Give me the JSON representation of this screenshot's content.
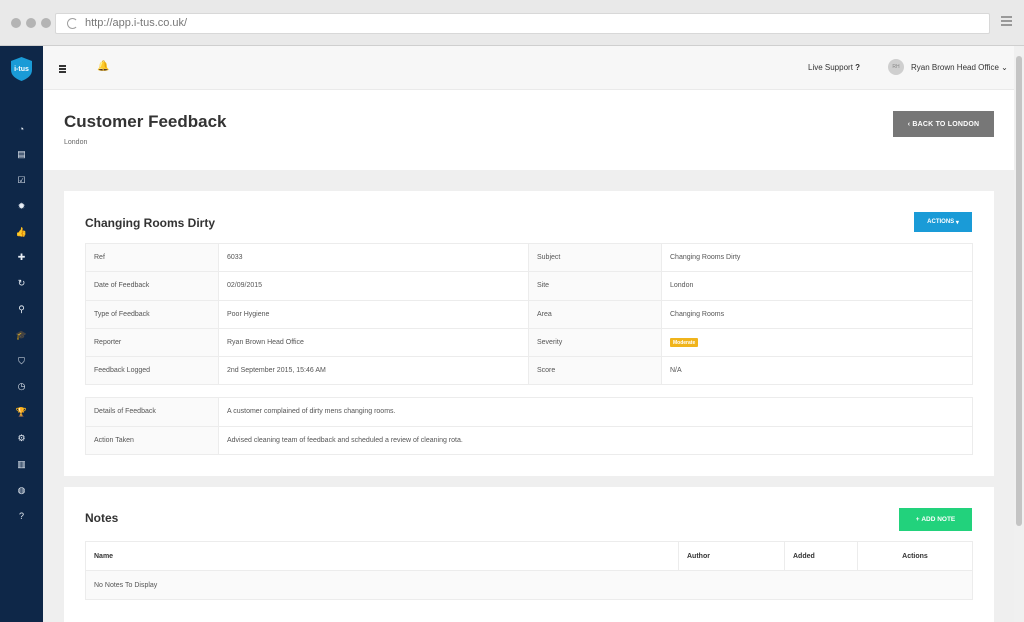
{
  "browser": {
    "url": "http://app.i-tus.co.uk/"
  },
  "brand": {
    "logo_text": "i-tus",
    "accent": "#1a9bd7"
  },
  "sidebar": {
    "items": [
      {
        "icon": "dashboard-icon",
        "glyph": "◔"
      },
      {
        "icon": "document-icon",
        "glyph": "▤"
      },
      {
        "icon": "checklist-icon",
        "glyph": "☑"
      },
      {
        "icon": "settings-cog-icon",
        "glyph": "✹"
      },
      {
        "icon": "thumbs-up-icon",
        "glyph": "👍"
      },
      {
        "icon": "medical-kit-icon",
        "glyph": "✚"
      },
      {
        "icon": "refresh-icon",
        "glyph": "↻"
      },
      {
        "icon": "search-zoom-icon",
        "glyph": "⚲"
      },
      {
        "icon": "graduation-cap-icon",
        "glyph": "🎓"
      },
      {
        "icon": "shield-icon",
        "glyph": "⛉"
      },
      {
        "icon": "clock-icon",
        "glyph": "◷"
      },
      {
        "icon": "trophy-icon",
        "glyph": "🏆"
      },
      {
        "icon": "gear-icon",
        "glyph": "⚙"
      },
      {
        "icon": "bar-chart-icon",
        "glyph": "▥"
      },
      {
        "icon": "globe-icon",
        "glyph": "◍"
      },
      {
        "icon": "help-icon",
        "glyph": "?"
      }
    ]
  },
  "topbar": {
    "live_support": "Live Support",
    "live_support_icon": "?",
    "avatar_initials": "RH",
    "user_name": "Ryan Brown Head Office"
  },
  "page": {
    "title": "Customer Feedback",
    "subtitle": "London",
    "back_button": "BACK TO LONDON"
  },
  "feedback": {
    "title": "Changing Rooms Dirty",
    "actions_button": "ACTIONS",
    "rows": [
      {
        "label": "Ref",
        "value": "6033",
        "label2": "Subject",
        "value2": "Changing Rooms Dirty"
      },
      {
        "label": "Date of Feedback",
        "value": "02/09/2015",
        "label2": "Site",
        "value2": "London"
      },
      {
        "label": "Type of Feedback",
        "value": "Poor Hygiene",
        "label2": "Area",
        "value2": "Changing Rooms"
      },
      {
        "label": "Reporter",
        "value": "Ryan Brown Head Office",
        "label2": "Severity",
        "value2": "Moderate"
      },
      {
        "label": "Feedback Logged",
        "value": "2nd September 2015, 15:46 AM",
        "label2": "Score",
        "value2": "N/A"
      }
    ],
    "severity_color": "#f0b41c",
    "details_label": "Details of Feedback",
    "details_value": "A customer complained of dirty mens changing rooms.",
    "action_label": "Action Taken",
    "action_value": "Advised cleaning team of feedback and scheduled a review of cleaning rota."
  },
  "notes": {
    "title": "Notes",
    "add_button": "ADD NOTE",
    "columns": [
      "Name",
      "Author",
      "Added",
      "Actions"
    ],
    "empty_text": "No Notes To Display"
  }
}
